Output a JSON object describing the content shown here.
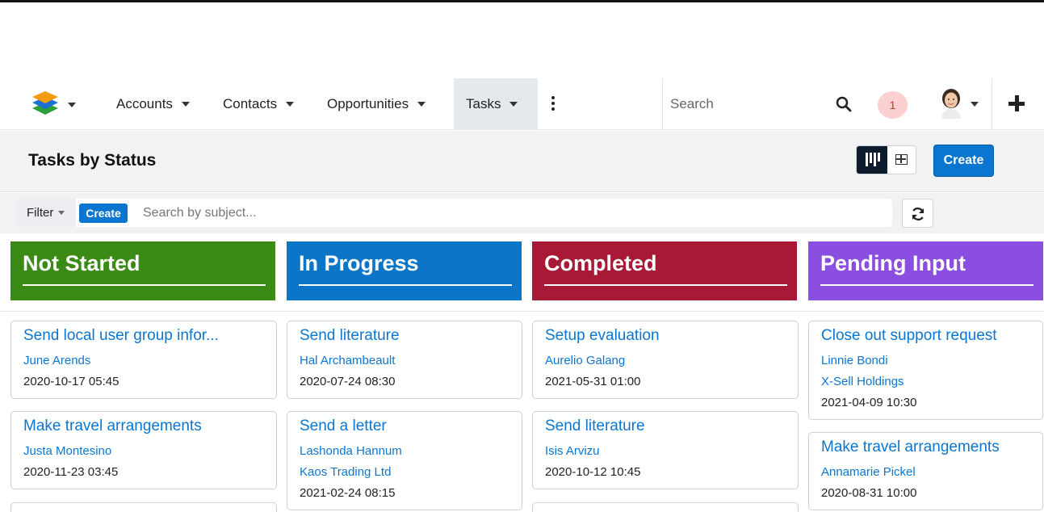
{
  "nav": {
    "items": [
      {
        "label": "Accounts"
      },
      {
        "label": "Contacts"
      },
      {
        "label": "Opportunities"
      },
      {
        "label": "Tasks"
      }
    ],
    "search_placeholder": "Search",
    "notification_count": "1"
  },
  "header": {
    "title": "Tasks by Status",
    "create_label": "Create"
  },
  "filter": {
    "filter_label": "Filter",
    "create_label": "Create",
    "search_placeholder": "Search by subject..."
  },
  "columns": [
    {
      "title": "Not Started",
      "color": "#3b8a16",
      "cards": [
        {
          "subject": "Send local user group infor...",
          "contact": "June Arends",
          "date": "2020-10-17 05:45"
        },
        {
          "subject": "Make travel arrangements",
          "contact": "Justa Montesino",
          "date": "2020-11-23 03:45"
        }
      ]
    },
    {
      "title": "In Progress",
      "color": "#0b76c8",
      "cards": [
        {
          "subject": "Send literature",
          "contact": "Hal Archambeault",
          "date": "2020-07-24 08:30"
        },
        {
          "subject": "Send a letter",
          "contact": "Lashonda Hannum",
          "account": "Kaos Trading Ltd",
          "date": "2021-02-24 08:15"
        }
      ]
    },
    {
      "title": "Completed",
      "color": "#a81936",
      "cards": [
        {
          "subject": "Setup evaluation",
          "contact": "Aurelio Galang",
          "date": "2021-05-31 01:00"
        },
        {
          "subject": "Send literature",
          "contact": "Isis Arvizu",
          "date": "2020-10-12 10:45"
        }
      ]
    },
    {
      "title": "Pending Input",
      "color": "#8a4ee0",
      "cards": [
        {
          "subject": "Close out support request",
          "contact": "Linnie Bondi",
          "account": "X-Sell Holdings",
          "date": "2021-04-09 10:30"
        },
        {
          "subject": "Make travel arrangements",
          "contact": "Annamarie Pickel",
          "date": "2020-08-31 10:00"
        }
      ]
    }
  ]
}
